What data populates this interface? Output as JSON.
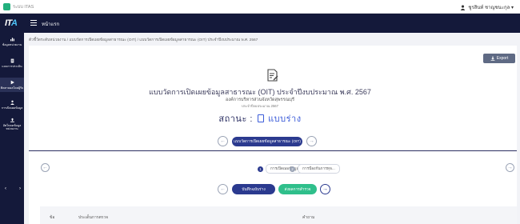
{
  "appbar": {
    "app_name": "ระบบ ITAS",
    "user": "ชูรสินท์ ชาญชนะกุล ▾"
  },
  "header": {
    "brand_main": "IT",
    "brand_accent": "A",
    "home_label": "หน้าแรก"
  },
  "sidebar": {
    "items": [
      {
        "label": "ข้อมูลหน่วยงาน"
      },
      {
        "label": "แบบการประเมิน"
      },
      {
        "label": "ติดตามผลโดยผู้รับ"
      },
      {
        "label": "การเปิดเผยข้อมูล"
      },
      {
        "label": "อัพโหลดข้อมูลหน่วยงาน"
      }
    ],
    "prev": "‹",
    "next": "›"
  },
  "breadcrumb": "ตัวชี้วัดระดับหน่วยงาน / แบบวัดการเปิดเผยข้อมูลสาธารณะ (OIT) / แบบวัดการเปิดเผยข้อมูลสาธารณะ (OIT) ประจำปีงบประมาณ พ.ศ. 2567",
  "export_label": "Export",
  "main": {
    "title": "แบบวัดการเปิดเผยข้อมูลสาธารณะ (OIT) ประจำปีงบประมาณ พ.ศ. 2567",
    "org": "องค์การบริหารส่วนจังหวัดสุพรรณบุรี",
    "year": "ประจำปีงบประมาณ 2567",
    "status_label": "สถานะ :",
    "status_value": "แบบร่าง",
    "oit_pill": "แบบวัดการเปิดเผยข้อมูลสาธารณะ (OIT)"
  },
  "steps": [
    {
      "num": "1",
      "label": "การเปิดเผยข้อมูล"
    },
    {
      "num": "2",
      "label": "การป้องกันการทุจ..."
    }
  ],
  "actions": {
    "save_draft": "บันทึกฉบับร่าง",
    "submit": "ส่งผลการสำรวจ"
  },
  "table": {
    "headers": [
      "ข้อ",
      "ประเด็นการตรวจ",
      "คำถาม"
    ]
  },
  "colors": {
    "navy": "#14193a",
    "primary": "#2b3a8f",
    "green": "#2fbf8b",
    "accent_blue": "#3a5bd8"
  }
}
